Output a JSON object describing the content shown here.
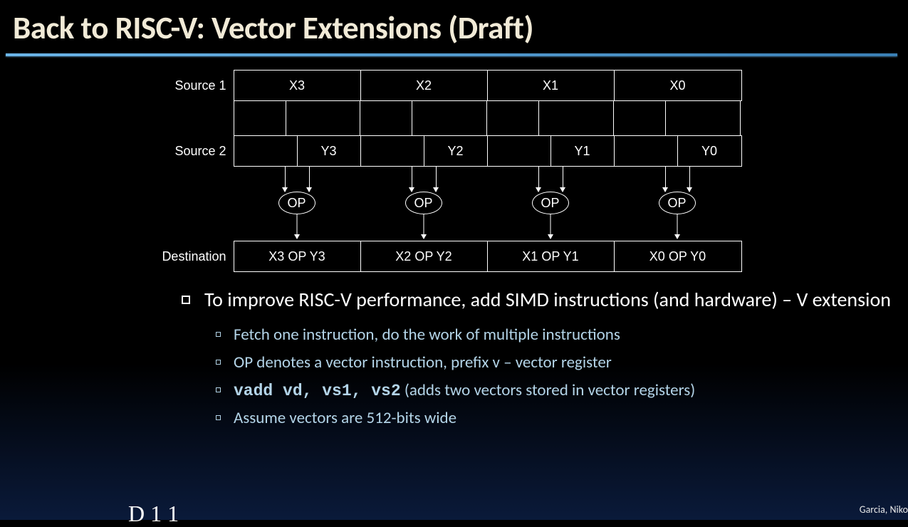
{
  "title": "Back to RISC-V: Vector Extensions (Draft)",
  "diagram": {
    "row1_label": "Source 1",
    "row1_cells": [
      "X3",
      "X2",
      "X1",
      "X0"
    ],
    "row2_label": "Source 2",
    "row2_cells": [
      "Y3",
      "Y2",
      "Y1",
      "Y0"
    ],
    "op_label": "OP",
    "row3_label": "Destination",
    "row3_cells": [
      "X3 OP Y3",
      "X2 OP Y2",
      "X1 OP Y1",
      "X0 OP Y0"
    ]
  },
  "main_bullet": "To improve RISC-V performance, add SIMD instructions (and hardware) – V extension",
  "sub_bullets": {
    "b1": "Fetch one instruction, do the work of multiple instructions",
    "b2": "OP denotes a vector instruction, prefix v – vector register",
    "b3_code": "vadd vd, vs1, vs2",
    "b3_text": "  (adds two vectors stored in vector registers)",
    "b4": "Assume vectors are 512-bits wide"
  },
  "footer_credit": "Garcia, Niko",
  "footer_left": "D   1    1"
}
